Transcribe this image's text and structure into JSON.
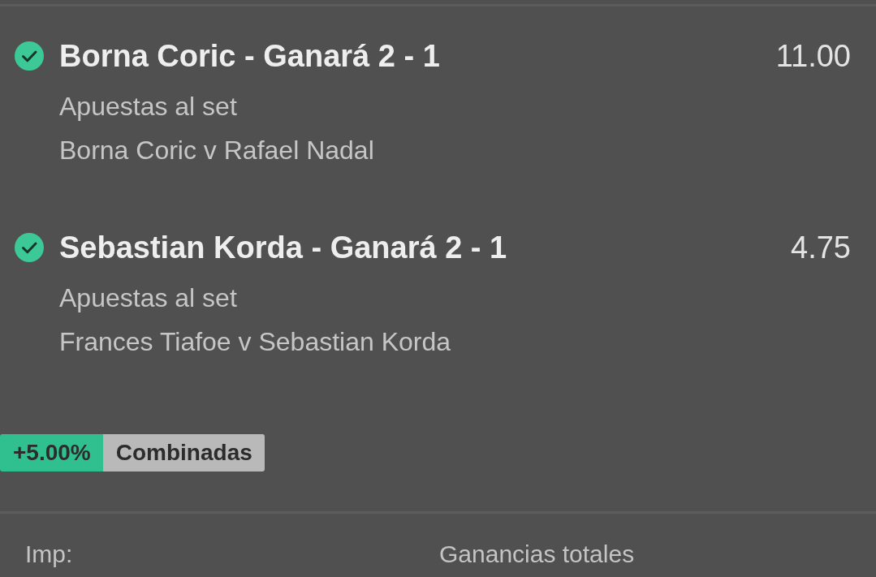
{
  "selections": [
    {
      "title": "Borna Coric - Ganará 2 - 1",
      "market": "Apuestas al set",
      "event": "Borna Coric v Rafael Nadal",
      "odds": "11.00",
      "checked": true
    },
    {
      "title": "Sebastian Korda - Ganará 2 - 1",
      "market": "Apuestas al set",
      "event": "Frances Tiafoe v Sebastian Korda",
      "odds": "4.75",
      "checked": true
    }
  ],
  "boost": {
    "percent": "+5.00%",
    "label": "Combinadas"
  },
  "footer": {
    "stake_label": "Imp:",
    "returns_label": "Ganancias totales"
  }
}
